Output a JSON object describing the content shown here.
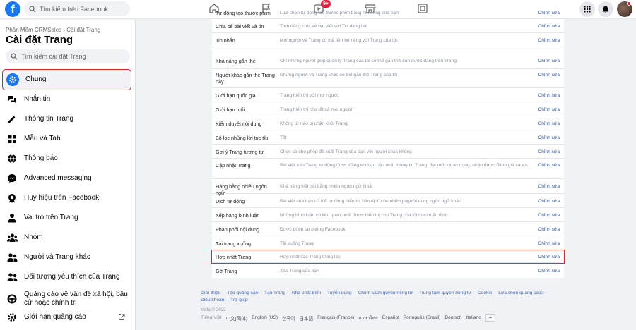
{
  "topbar": {
    "logo": "f",
    "search_placeholder": "Tìm kiếm trên Facebook",
    "notification_badge": "9+",
    "icons": [
      "home-icon",
      "flag-icon",
      "video-icon",
      "marketplace-icon",
      "gaming-icon",
      "menu-grid-icon",
      "bell-icon"
    ]
  },
  "sidebar": {
    "breadcrumb": "Phần Mềm CRMSales › Cài đặt Trang",
    "title": "Cài đặt Trang",
    "search_placeholder": "Tìm kiếm cài đặt Trang",
    "items": [
      {
        "label": "Chung",
        "icon": "gear-icon",
        "active": true
      },
      {
        "label": "Nhắn tin",
        "icon": "chat-icon"
      },
      {
        "label": "Thông tin Trang",
        "icon": "pencil-icon"
      },
      {
        "label": "Mẫu và Tab",
        "icon": "grid-icon"
      },
      {
        "label": "Thông báo",
        "icon": "globe-icon"
      },
      {
        "label": "Advanced messaging",
        "icon": "messenger-icon"
      },
      {
        "label": "Huy hiệu trên Facebook",
        "icon": "badge-icon"
      },
      {
        "label": "Vai trò trên Trang",
        "icon": "person-icon"
      },
      {
        "label": "Nhóm",
        "icon": "group-icon"
      },
      {
        "label": "Người và Trang khác",
        "icon": "people-icon"
      },
      {
        "label": "Đối tượng yêu thích của Trang",
        "icon": "people-icon"
      },
      {
        "label": "Quảng cáo về vấn đề xã hội, bầu cử hoặc chính trị",
        "icon": "steering-icon"
      },
      {
        "label": "Giới hạn quảng cáo",
        "icon": "gear-icon"
      }
    ]
  },
  "settings": {
    "rows": [
      {
        "name": "Tự động tạo thước phim",
        "value": "Lựa chọn tự động tạo thước phim bằng nội dung của bạn",
        "edit": "Chỉnh sửa"
      },
      {
        "name": "Chia sẻ bài viết và tin",
        "value": "Tính năng chia sẻ bài viết với Tin đang bật",
        "edit": "Chỉnh sửa"
      },
      {
        "name": "Tin nhắn",
        "value": "Mọi người và Trang có thể liên hệ riêng với Trang của tôi.",
        "edit": "Chỉnh sửa"
      },
      {
        "name": "Khả năng gắn thẻ",
        "value": "Chỉ những người giúp quản lý Trang của tôi có thể gắn thẻ ảnh được đăng trên Trang.",
        "edit": "Chỉnh sửa"
      },
      {
        "name": "Người khác gắn thẻ Trang này",
        "value": "Những người và Trang khác có thể gắn thẻ Trang của tôi.",
        "edit": "Chỉnh sửa"
      },
      {
        "name": "Giới hạn quốc gia",
        "value": "Trang hiển thị với mọi người.",
        "edit": "Chỉnh sửa"
      },
      {
        "name": "Giới hạn tuổi",
        "value": "Trang hiển thị cho tất cả mọi người.",
        "edit": "Chỉnh sửa"
      },
      {
        "name": "Kiểm duyệt nội dung",
        "value": "Không từ nào bị chặn khỏi Trang.",
        "edit": "Chỉnh sửa"
      },
      {
        "name": "Bộ lọc những lời tục tĩu",
        "value": "Tắt",
        "edit": "Chỉnh sửa"
      },
      {
        "name": "Gợi ý Trang tương tự",
        "value": "Chọn có cho phép đề xuất Trang của bạn với người khác không",
        "edit": "Chỉnh sửa"
      },
      {
        "name": "Cập nhật Trang",
        "value": "Bài viết trên Trang tự động được đăng khi bạn cập nhật thông tin Trang, đạt mốc quan trọng, nhận được đánh giá và v.v.",
        "edit": "Chỉnh sửa"
      },
      {
        "name": "Đăng bằng nhiều ngôn ngữ",
        "value": "Khả năng viết bài bằng nhiều ngôn ngữ bị tắt",
        "edit": "Chỉnh sửa"
      },
      {
        "name": "Dịch tự động",
        "value": "Bài viết của bạn có thể tự động hiển thị bản dịch cho những người dùng ngôn ngữ khác.",
        "edit": "Chỉnh sửa"
      },
      {
        "name": "Xếp hạng bình luận",
        "value": "Những bình luận có liên quan nhất được hiển thị cho Trang của tôi theo mặc định.",
        "edit": "Chỉnh sửa"
      },
      {
        "name": "Phân phối nội dung",
        "value": "Được phép tải xuống Facebook",
        "edit": "Chỉnh sửa"
      },
      {
        "name": "Tải trang xuống",
        "value": "Tải xuống Trang",
        "edit": "Chỉnh sửa"
      },
      {
        "name": "Hợp nhất Trang",
        "value": "Hợp nhất các Trang trùng lặp",
        "edit": "Chỉnh sửa",
        "highlight": true
      },
      {
        "name": "Gỡ Trang",
        "value": "Xóa Trang của bạn",
        "edit": "Chỉnh sửa"
      }
    ]
  },
  "footer": {
    "links": [
      "Giới thiệu",
      "Tạo quảng cáo",
      "Tạo Trang",
      "Nhà phát triển",
      "Tuyển dụng",
      "Chính sách quyền riêng tư",
      "Trung tâm quyền riêng tư",
      "Cookie",
      "Lựa chọn quảng cáo▷"
    ],
    "links2": [
      "Điều khoản",
      "Trợ giúp"
    ],
    "copyright": "Meta © 2022",
    "languages": [
      "Tiếng Việt",
      "中文(简体)",
      "English (US)",
      "한국어",
      "日本語",
      "Français (France)",
      "ภาษาไทย",
      "Español",
      "Português (Brasil)",
      "Deutsch",
      "Italiano"
    ],
    "more_button": "+"
  },
  "colors": {
    "brand": "#1877f2",
    "link": "#385898",
    "highlight_outline": "#d62a2a"
  }
}
